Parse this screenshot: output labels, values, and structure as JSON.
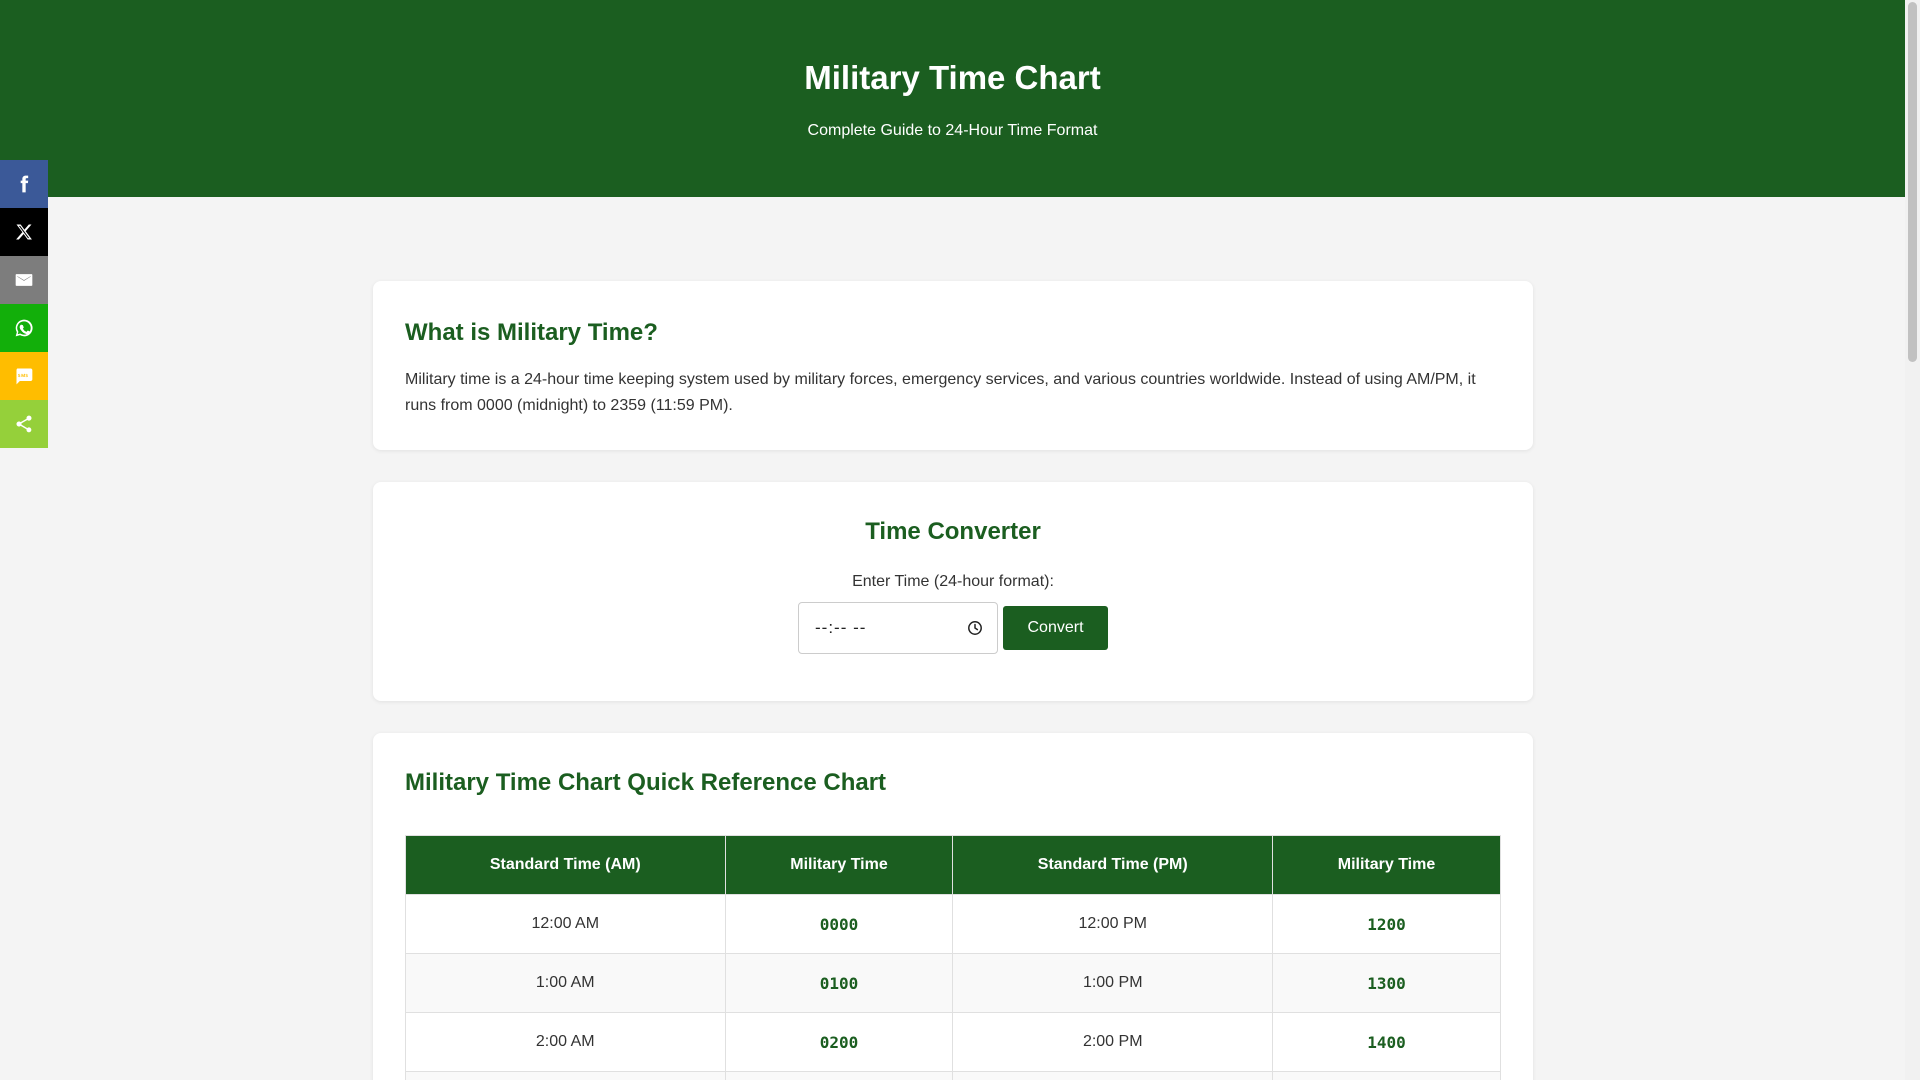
{
  "header": {
    "title": "Military Time Chart",
    "subtitle": "Complete Guide to 24-Hour Time Format"
  },
  "share": {
    "items": [
      {
        "icon": "facebook-icon",
        "color": "#3b5998"
      },
      {
        "icon": "x-twitter-icon",
        "color": "#000000"
      },
      {
        "icon": "email-icon",
        "color": "#7d7d7d"
      },
      {
        "icon": "whatsapp-icon",
        "color": "#12af0a"
      },
      {
        "icon": "sms-icon",
        "color": "#ffbd00"
      },
      {
        "icon": "share-icon",
        "color": "#95d03a"
      }
    ]
  },
  "intro": {
    "heading": "What is Military Time?",
    "body": "Military time is a 24-hour time keeping system used by military forces, emergency services, and various countries worldwide. Instead of using AM/PM, it runs from 0000 (midnight) to 2359 (11:59 PM)."
  },
  "converter": {
    "heading": "Time Converter",
    "label": "Enter Time (24-hour format):",
    "input_value": "--:-- --",
    "button_label": "Convert"
  },
  "reference": {
    "heading": "Military Time Chart Quick Reference Chart",
    "columns": [
      "Standard Time (AM)",
      "Military Time",
      "Standard Time (PM)",
      "Military Time"
    ],
    "rows": [
      [
        "12:00 AM",
        "0000",
        "12:00 PM",
        "1200"
      ],
      [
        "1:00 AM",
        "0100",
        "1:00 PM",
        "1300"
      ],
      [
        "2:00 AM",
        "0200",
        "2:00 PM",
        "1400"
      ]
    ]
  },
  "colors": {
    "brand_green": "#1b5e20",
    "page_background": "#f4f4f4"
  }
}
